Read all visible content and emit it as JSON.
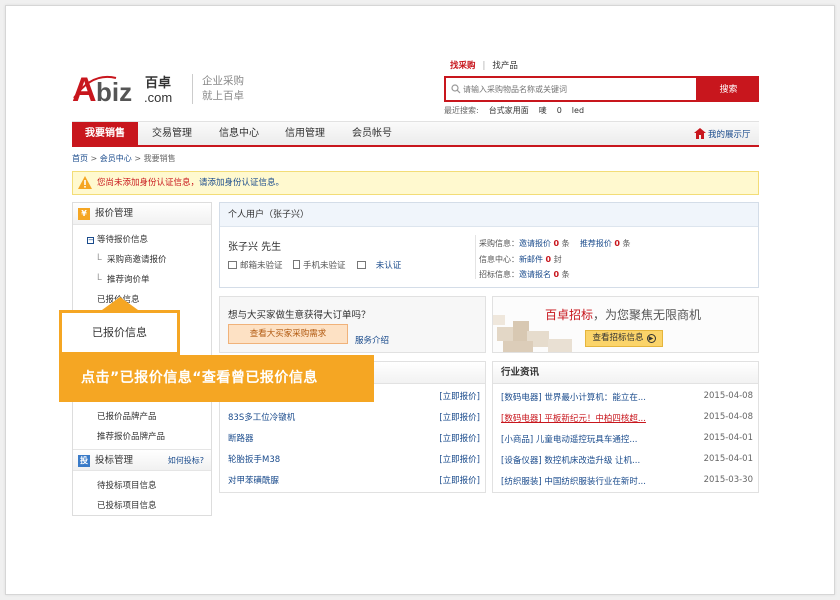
{
  "header": {
    "logo_text": "Abiz",
    "logo_cn": "百卓",
    "logo_domain": ".com",
    "slogan_1": "企业采购",
    "slogan_2": "就上百卓",
    "search_tabs": [
      "找采购",
      "找产品"
    ],
    "search_placeholder": "请输入采购物品名称或关键词",
    "search_button": "搜索",
    "recent_label": "最近搜索:",
    "recent_terms": [
      "台式家用面",
      "唛",
      "0",
      "led"
    ]
  },
  "nav": {
    "items": [
      "我要销售",
      "交易管理",
      "信息中心",
      "信用管理",
      "会员帐号"
    ],
    "showroom": "我的展示厅"
  },
  "breadcrumb": [
    "首页",
    "会员中心",
    "我要销售"
  ],
  "notice": {
    "text": "您尚未添加身份认证信息，",
    "link": "请添加身份认证信息。"
  },
  "sidebar": {
    "section1_title": "报价管理",
    "wait_label": "等待报价信息",
    "sub1": "采购商邀请报价",
    "sub2": "推荐询价单",
    "quoted": "已报价信息",
    "quoted_brand": "已报价品牌产品",
    "recommend_brand": "推荐报价品牌产品",
    "section2_title": "投标管理",
    "howto": "如何投标?",
    "bid_wait": "待投标项目信息",
    "bid_done": "已投标项目信息"
  },
  "callout": {
    "label": "已报价信息",
    "banner": "点击”已报价信息“查看曾已报价信息"
  },
  "user": {
    "type": "个人用户（张子兴）",
    "name": "张子兴 先生",
    "email_status": "邮箱未验证",
    "phone_status": "手机未验证",
    "cert_status": "未认证",
    "stats": [
      {
        "label": "采购信息：",
        "link": "邀请报价",
        "num": "0",
        "unit": "条",
        "link2": "推荐报价",
        "num2": "0",
        "unit2": "条"
      },
      {
        "label": "信息中心：",
        "link": "新邮件",
        "num": "0",
        "unit": "封"
      },
      {
        "label": "招标信息：",
        "link": "邀请报名",
        "num": "0",
        "unit": "条"
      }
    ]
  },
  "ask": {
    "title": "想与大买家做生意获得大订单吗？",
    "button": "查看大买家采购需求",
    "service": "服务介绍"
  },
  "ad": {
    "title_red": "百卓招标",
    "title_rest": "，为您聚焦无限商机",
    "button": "查看招标信息"
  },
  "list": {
    "action": "[立即报价]",
    "rows": [
      "83S多工位冷镦机",
      "断路器",
      "轮胎扳手M38",
      "对甲苯磺酰脲"
    ]
  },
  "news": {
    "title": "行业资讯",
    "rows": [
      {
        "text": "[数码电器] 世界最小计算机：能立在...",
        "date": "2015-04-08",
        "red": false
      },
      {
        "text": "[数码电器] 平板新纪元！中柏四核超...",
        "date": "2015-04-08",
        "red": true
      },
      {
        "text": "[小商品] 儿童电动遥控玩具车通控...",
        "date": "2015-04-01",
        "red": false
      },
      {
        "text": "[设备仪器] 数控机床改造升级 让机...",
        "date": "2015-04-01",
        "red": false
      },
      {
        "text": "[纺织服装] 中国纺织服装行业在新时...",
        "date": "2015-03-30",
        "red": false
      }
    ]
  },
  "colors": {
    "brand_red": "#c8161d",
    "link_blue": "#1a4b8c",
    "callout_orange": "#f5a623"
  }
}
